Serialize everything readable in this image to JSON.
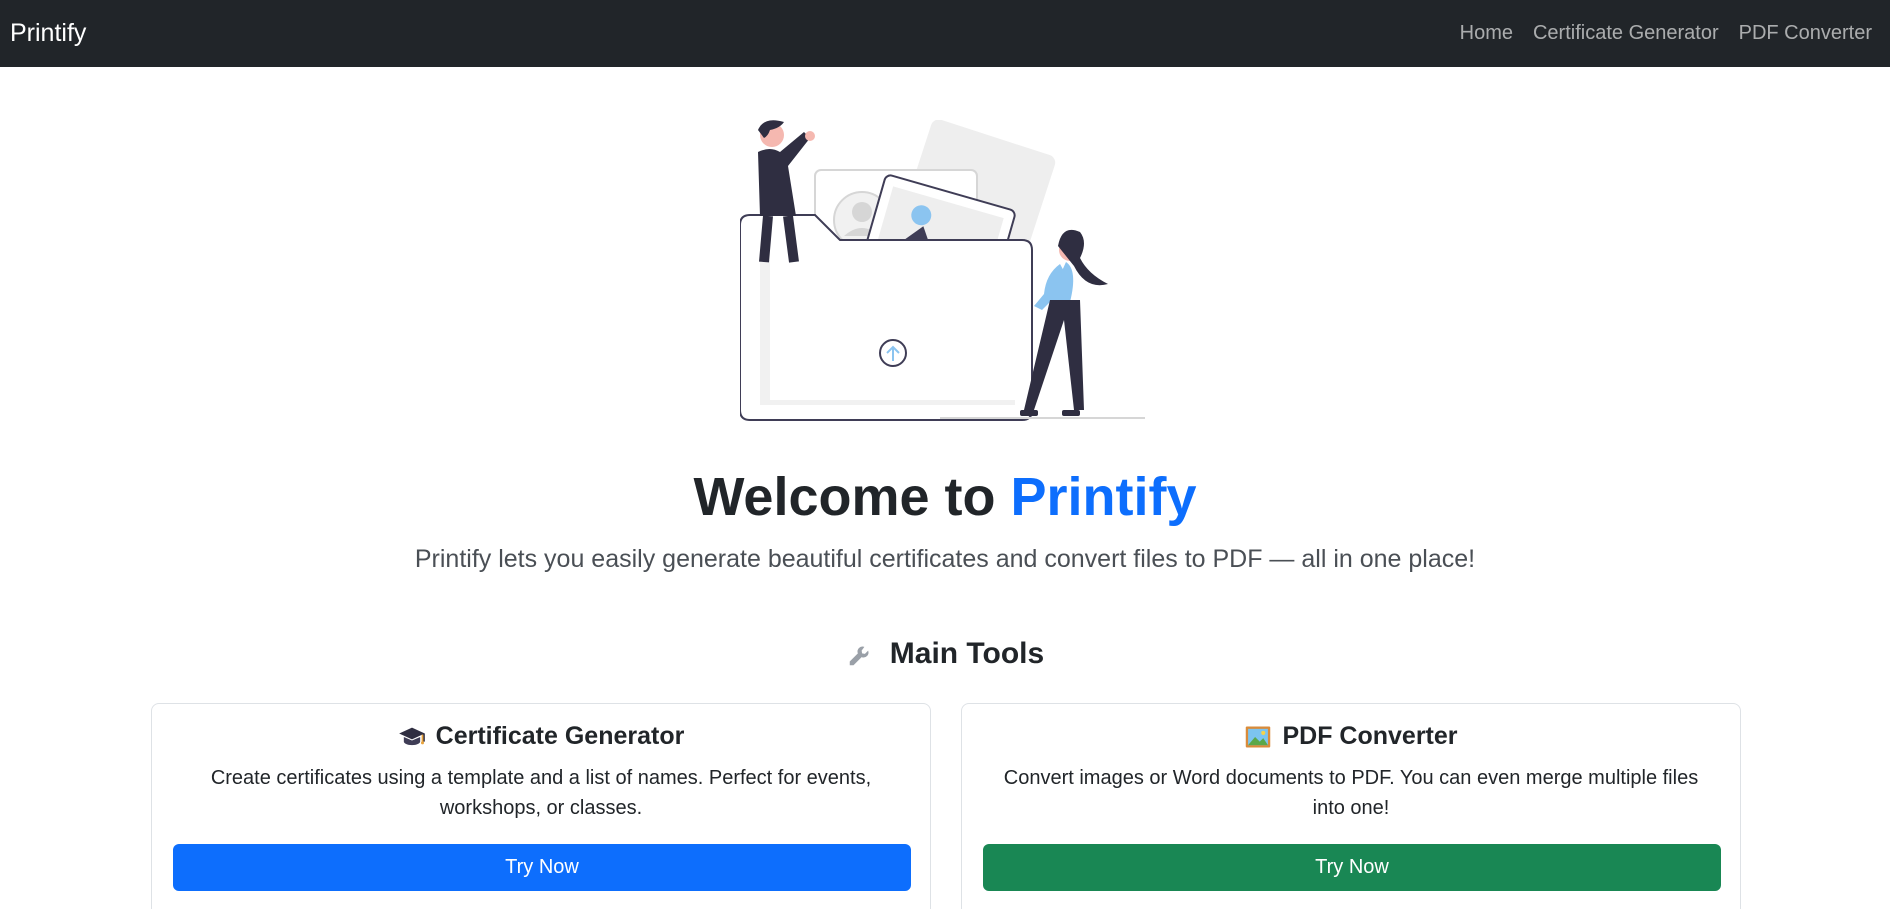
{
  "navbar": {
    "brand": "Printify",
    "links": [
      "Home",
      "Certificate Generator",
      "PDF Converter"
    ]
  },
  "hero": {
    "title_prefix": "Welcome to ",
    "title_accent": "Printify",
    "subtitle": "Printify lets you easily generate beautiful certificates and convert files to PDF — all in one place!"
  },
  "tools_section": {
    "icon": "wrench-icon",
    "title": "Main Tools"
  },
  "cards": [
    {
      "icon": "graduation-cap-icon",
      "title": "Certificate Generator",
      "text": "Create certificates using a template and a list of names. Perfect for events, workshops, or classes.",
      "button_label": "Try Now",
      "button_color": "#0d6efd"
    },
    {
      "icon": "framed-picture-icon",
      "title": "PDF Converter",
      "text": "Convert images or Word documents to PDF. You can even merge multiple files into one!",
      "button_label": "Try Now",
      "button_color": "#198754"
    }
  ],
  "colors": {
    "navbar_bg": "#212529",
    "accent": "#0d6efd",
    "success": "#198754"
  }
}
